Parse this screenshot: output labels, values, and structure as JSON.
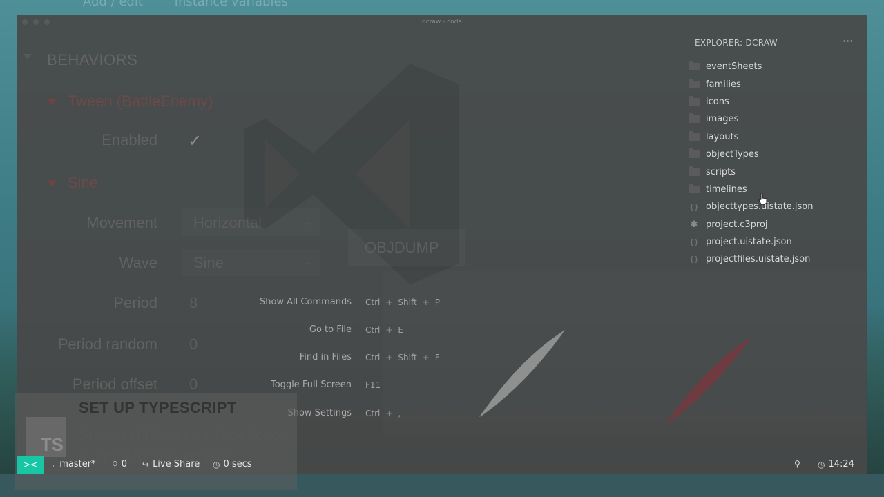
{
  "window": {
    "title": "dcraw - code"
  },
  "background_app": {
    "top_labels": [
      "Add / edit",
      "Instance variables"
    ],
    "behaviors_title": "BEHAVIORS",
    "tween_label": "Tween (BattleEnemy)",
    "enabled_label": "Enabled",
    "sine_label": "Sine",
    "properties": [
      {
        "label": "Movement",
        "value": "Horizontal"
      },
      {
        "label": "Wave",
        "value": "Sine"
      },
      {
        "label": "Period",
        "value": "8"
      },
      {
        "label": "Period random",
        "value": "0"
      },
      {
        "label": "Period offset",
        "value": "0"
      }
    ],
    "objdump_label": "OBJDUMP"
  },
  "commands": [
    {
      "name": "Show All Commands",
      "keys": [
        "Ctrl",
        "Shift",
        "P"
      ]
    },
    {
      "name": "Go to File",
      "keys": [
        "Ctrl",
        "E"
      ]
    },
    {
      "name": "Find in Files",
      "keys": [
        "Ctrl",
        "Shift",
        "F"
      ]
    },
    {
      "name": "Toggle Full Screen",
      "keys": [
        "F11"
      ]
    },
    {
      "name": "Show Settings",
      "keys": [
        "Ctrl",
        ","
      ]
    }
  ],
  "explorer": {
    "header": "EXPLORER: DCRAW",
    "more_icon": "ellipsis-icon",
    "items": [
      {
        "label": "eventSheets",
        "type": "folder"
      },
      {
        "label": "families",
        "type": "folder"
      },
      {
        "label": "icons",
        "type": "folder"
      },
      {
        "label": "images",
        "type": "folder"
      },
      {
        "label": "layouts",
        "type": "folder"
      },
      {
        "label": "objectTypes",
        "type": "folder"
      },
      {
        "label": "scripts",
        "type": "folder"
      },
      {
        "label": "timelines",
        "type": "folder"
      },
      {
        "label": "objecttypes.uistate.json",
        "type": "json"
      },
      {
        "label": "project.c3proj",
        "type": "config"
      },
      {
        "label": "project.uistate.json",
        "type": "json"
      },
      {
        "label": "projectfiles.uistate.json",
        "type": "json"
      }
    ]
  },
  "notification": {
    "logo_text": "TS",
    "title": "SET UP TYPESCRIPT",
    "body": "Successfully set up TypeScript support for this project."
  },
  "statusbar": {
    "branch": "master*",
    "ports": "0",
    "live_share": "Live Share",
    "timer": "0 secs",
    "clock": "14:24"
  },
  "colors": {
    "accent": "#16c6a4",
    "window_bg": "#484848",
    "tween_red": "#6c4a4a"
  }
}
